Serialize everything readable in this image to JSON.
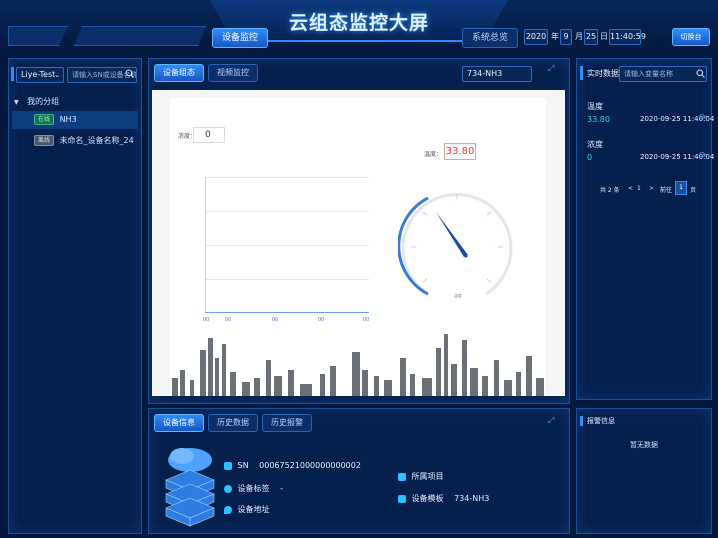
{
  "header": {
    "title": "云组态监控大屏",
    "tabs": [
      {
        "label": "设备监控",
        "active": true
      },
      {
        "label": "系统总览",
        "active": false
      }
    ],
    "date": {
      "year": "2020",
      "year_unit": "年",
      "month": "9",
      "month_unit": "月",
      "day": "25",
      "day_unit": "日",
      "time": "11:40:59"
    },
    "right_button": "切换台"
  },
  "left_panel": {
    "group_select": "Liye-Test",
    "search_placeholder": "请输入SN或设备名称",
    "tree": {
      "group_label": "我的分组",
      "items": [
        {
          "status": "在线",
          "name": "NH3",
          "status_color": "#38b07b"
        },
        {
          "status": "离线",
          "name": "未命名_设备名称_24",
          "status_color": "#8090a8"
        }
      ]
    }
  },
  "center_panel": {
    "tabs": [
      {
        "label": "设备组态",
        "active": true
      },
      {
        "label": "视频监控",
        "active": false
      }
    ],
    "device_name": "734-NH3",
    "canvas": {
      "concentration_label": "浓度：",
      "concentration_value": "0",
      "temperature_label": "温度：",
      "temperature_value": "33.80",
      "x_ticks": [
        "00",
        "00",
        "00",
        "00",
        "00"
      ],
      "gauge_label": "温度"
    }
  },
  "right_panel": {
    "title": "实时数据",
    "search_placeholder": "请输入变量名称",
    "items": [
      {
        "name": "温度",
        "value": "33.80",
        "time": "2020-09-25 11:40:04"
      },
      {
        "name": "浓度",
        "value": "0",
        "time": "2020-09-25 11:40:04"
      }
    ],
    "pagination": {
      "total": "共 2 条",
      "prev": "<",
      "page": "1",
      "next": ">",
      "goto_label": "前往",
      "goto_value": "1",
      "goto_unit": "页"
    }
  },
  "bottom_panel": {
    "tabs": [
      {
        "label": "设备信息",
        "active": true
      },
      {
        "label": "历史数据",
        "active": false
      },
      {
        "label": "历史报警",
        "active": false
      }
    ],
    "info": {
      "sn_label": "SN",
      "sn_value": "00067521000000000002",
      "tag_label": "设备标签",
      "tag_value": "-",
      "address_label": "设备地址",
      "project_label": "所属项目",
      "template_label": "设备模板",
      "template_value": "734-NH3"
    }
  },
  "alarm_panel": {
    "title": "报警信息",
    "empty_text": "暂无数据"
  },
  "colors": {
    "background": "#04193d",
    "accent": "#2f8df6",
    "temperature_value": "#e0403a",
    "online": "#38b07b"
  }
}
